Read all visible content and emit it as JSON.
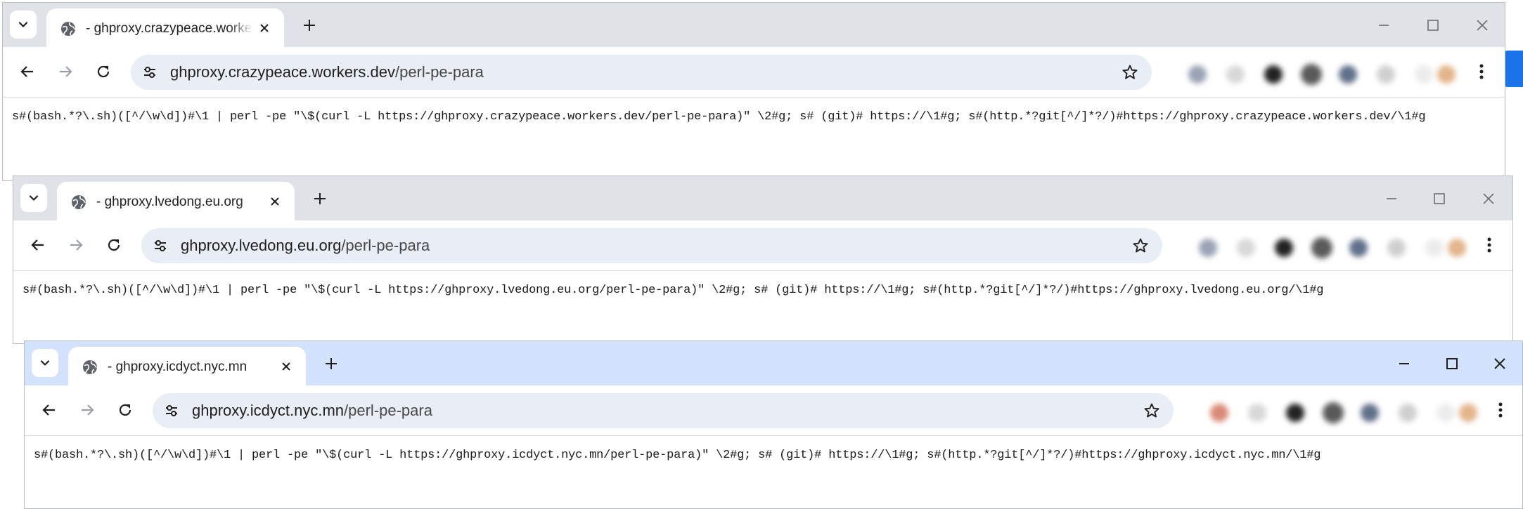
{
  "windows": [
    {
      "tab_title": "- ghproxy.crazypeace.workers.dev",
      "url_host": "ghproxy.crazypeace.workers.dev",
      "url_path": "/perl-pe-para",
      "page_text": "s#(bash.*?\\.sh)([^/\\w\\d])#\\1 | perl -pe \"\\$(curl -L https://ghproxy.crazypeace.workers.dev/perl-pe-para)\" \\2#g; s# (git)# https://\\1#g; s#(http.*?git[^/]*?/)#https://ghproxy.crazypeace.workers.dev/\\1#g"
    },
    {
      "tab_title": "- ghproxy.lvedong.eu.org",
      "url_host": "ghproxy.lvedong.eu.org",
      "url_path": "/perl-pe-para",
      "page_text": "s#(bash.*?\\.sh)([^/\\w\\d])#\\1 | perl -pe \"\\$(curl -L https://ghproxy.lvedong.eu.org/perl-pe-para)\" \\2#g; s# (git)# https://\\1#g; s#(http.*?git[^/]*?/)#https://ghproxy.lvedong.eu.org/\\1#g"
    },
    {
      "tab_title": "- ghproxy.icdyct.nyc.mn",
      "url_host": "ghproxy.icdyct.nyc.mn",
      "url_path": "/perl-pe-para",
      "page_text": "s#(bash.*?\\.sh)([^/\\w\\d])#\\1 | perl -pe \"\\$(curl -L https://ghproxy.icdyct.nyc.mn/perl-pe-para)\" \\2#g; s# (git)# https://\\1#g; s#(http.*?git[^/]*?/)#https://ghproxy.icdyct.nyc.mn/\\1#g"
    }
  ],
  "icons": {
    "tab_search": "chevron-down-icon",
    "favicon": "globe-icon",
    "close_tab": "close-icon",
    "new_tab": "plus-icon",
    "minimize": "minimize-icon",
    "maximize": "maximize-icon",
    "close_window": "close-icon",
    "back": "back-arrow-icon",
    "forward": "forward-arrow-icon",
    "reload": "reload-icon",
    "site_info": "tune-icon",
    "bookmark": "star-icon",
    "menu": "kebab-menu-icon"
  },
  "colors": {
    "tabstrip_inactive": "#dfe3e8",
    "tabstrip_active": "#d3e3fd",
    "omnibox": "#e9eef6",
    "accent": "#1a73e8"
  }
}
